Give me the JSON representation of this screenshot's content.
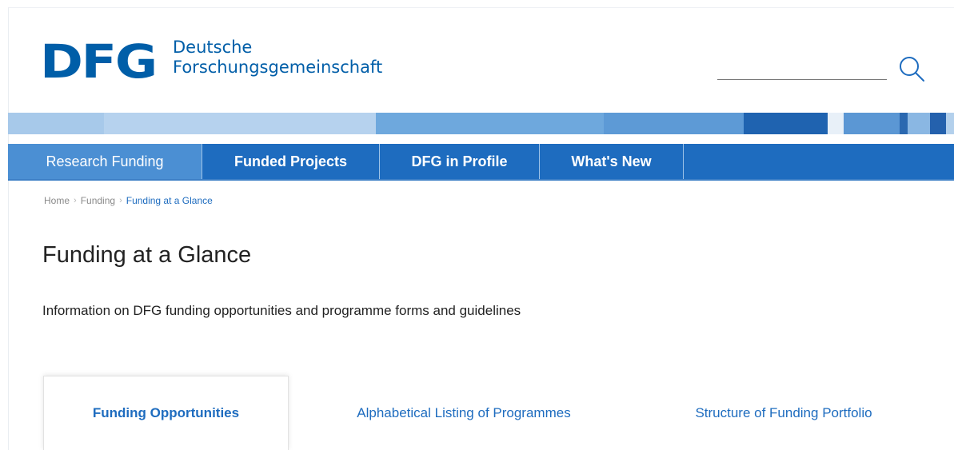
{
  "header": {
    "logo_mark": "DFG",
    "logo_line1": "Deutsche",
    "logo_line2": "Forschungsgemeinschaft",
    "search_value": "",
    "search_icon": "search-icon"
  },
  "stripe_colors": [
    "#9dc3e8",
    "#8ebbe5",
    "#6fa7dc",
    "#5a98d6",
    "#3b7fc4",
    "#1e5ea8",
    "#e6eef7",
    "#2f6db5"
  ],
  "nav": {
    "items": [
      {
        "label": "Research Funding",
        "active": true
      },
      {
        "label": "Funded Projects",
        "active": false
      },
      {
        "label": "DFG in Profile",
        "active": false
      },
      {
        "label": "What's New",
        "active": false
      }
    ],
    "bar_color": "#1e6cbf",
    "active_color": "#4b8fd3"
  },
  "breadcrumb": {
    "items": [
      "Home",
      "Funding",
      "Funding at a Glance"
    ],
    "separator": "›"
  },
  "main": {
    "title": "Funding at a Glance",
    "subtitle": "Information on DFG funding opportunities and programme forms and guidelines"
  },
  "tabs": {
    "items": [
      {
        "label": "Funding Opportunities",
        "active": true
      },
      {
        "label": "Alphabetical Listing of Programmes",
        "active": false
      },
      {
        "label": "Structure of Funding Portfolio",
        "active": false
      }
    ]
  },
  "colors": {
    "brand_blue": "#005ea8",
    "link_blue": "#1e6cbf"
  }
}
